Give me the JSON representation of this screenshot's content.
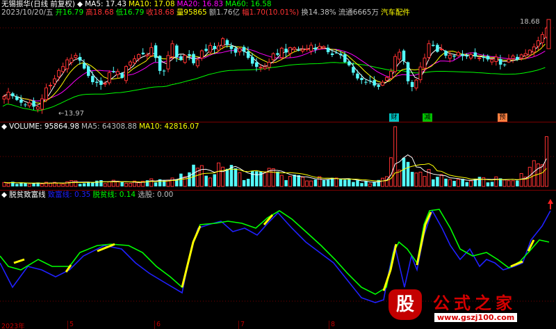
{
  "price_header": {
    "line1": [
      {
        "text": "无锡振华(日线 前复权)",
        "color": "#ffffff"
      },
      {
        "text": "◆",
        "color": "#ffffff"
      },
      {
        "text": "MA5: 17.43",
        "color": "#ffffff"
      },
      {
        "text": "MA10: 17.08",
        "color": "#ffff00"
      },
      {
        "text": "MA20: 16.83",
        "color": "#ff00ff"
      },
      {
        "text": "MA60: 16.58",
        "color": "#00ff00"
      }
    ],
    "line2": [
      {
        "text": "2023/10/20/五",
        "color": "#c0c0c0"
      },
      {
        "text": "开16.79",
        "color": "#00ff00"
      },
      {
        "text": "高18.68",
        "color": "#ff3232"
      },
      {
        "text": "低16.79",
        "color": "#00ff00"
      },
      {
        "text": "收18.68",
        "color": "#ff3232"
      },
      {
        "text": "量95865",
        "color": "#ffff00"
      },
      {
        "text": "额1.76亿",
        "color": "#c0c0c0"
      },
      {
        "text": "幅1.70(10.01%)",
        "color": "#ff3232"
      },
      {
        "text": "换14.38%",
        "color": "#c0c0c0"
      },
      {
        "text": "流通6665万",
        "color": "#c0c0c0"
      },
      {
        "text": "汽车配件",
        "color": "#ffff00"
      }
    ],
    "high_label": "18.68",
    "low_label": "13.97"
  },
  "badges": [
    {
      "text": "财",
      "color": "#00c0c0"
    },
    {
      "text": "减",
      "color": "#00c000"
    },
    {
      "text": "预",
      "color": "#ff8040"
    }
  ],
  "volume_header": [
    {
      "text": "◆",
      "color": "#ffffff"
    },
    {
      "text": "VOLUME: 95864.98",
      "color": "#ffffff"
    },
    {
      "text": "MA5: 64308.88",
      "color": "#c0c0c0"
    },
    {
      "text": "MA10: 42816.07",
      "color": "#ffff00"
    }
  ],
  "indicator_header": [
    {
      "text": "◆",
      "color": "#ffffff"
    },
    {
      "text": "脱贫致富线",
      "color": "#ffffff"
    },
    {
      "text": "致富线: 0.35",
      "color": "#2020ff"
    },
    {
      "text": "脱贫线: 0.14",
      "color": "#00ff00"
    },
    {
      "text": "选股: 0.00",
      "color": "#c0c0c0"
    }
  ],
  "x_axis_labels": [
    "2023年",
    "5",
    "6",
    "7",
    "8"
  ],
  "watermark": {
    "logo": "股",
    "title": "公式之家",
    "url": "www.gszj100.com"
  },
  "colors": {
    "up": "#ff3232",
    "down": "#54fcfc",
    "ma5": "#ffffff",
    "ma10": "#ffff00",
    "ma20": "#ff00ff",
    "ma60": "#00ff00",
    "rich_line": "#2020ff",
    "poverty_line": "#00ff00",
    "signal": "#ffff00",
    "grid": "#7a0000"
  }
}
